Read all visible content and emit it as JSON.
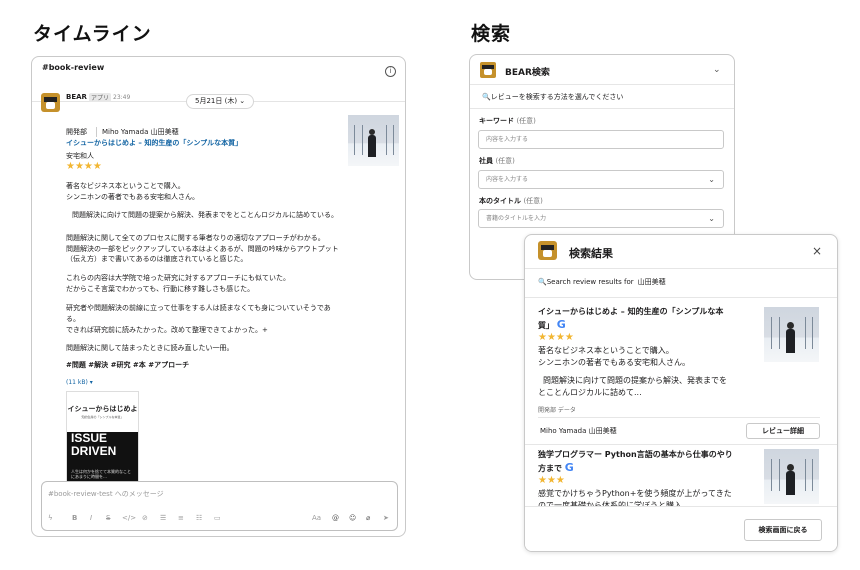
{
  "headings": {
    "timeline": "タイムライン",
    "search": "検索"
  },
  "timeline": {
    "channel": "#book-review",
    "date_pill": "5月21日 (木) ⌄",
    "bot_name": "BEAR",
    "app_badge": "アプリ",
    "time": "23:49",
    "department": "開発部",
    "person": "Miho Yamada 山田美穂",
    "book_title": "イシューからはじめよ – 知的生産の「シンプルな本質」",
    "author": "安宅和人",
    "stars": "★★★★",
    "lines": [
      "著名なビジネス本ということで購入。",
      "シンニホンの著者でもある安宅和人さん。",
      "問題解決に向けて問題の提案から解決、発表までをとことんロジカルに詰めている。",
      "問題解決に関して全てのプロセスに関する筆者なりの適切なアプローチがわかる。",
      "問題解決の一部をピックアップしている本はよくあるが、問題の吟味からアウトプット",
      "（伝え方）まで書いてあるのは徹底されていると感じた。",
      "これらの内容は大学院で培った研究に対するアプローチにも似ていた。",
      "だからこそ言葉でわかっても、行動に移す難しさも感じた。",
      "研究者や問題解決の前線に立って仕事をする人は読まなくても身についていそうであ",
      "る。",
      "できれば研究前に読みたかった。改めて整理できてよかった。+",
      "問題解決に関して詰まったときに読み直したい一冊。"
    ],
    "hashtags": "#問題 #解決 #研究 #本 #アプローチ",
    "file_size": "(11 kB) ▾",
    "book_cover": {
      "title": "イシューからはじめよ",
      "subtitle": "知的生産の「シンプルな本質」",
      "big_text": "ISSUE DRIVEN",
      "small_text": "人生は何かを捨てて本質的なことにあまりに時間を…"
    },
    "message_placeholder": "#book-review-test へのメッセージ",
    "toolbar_left": [
      "ϟ",
      "B",
      "I",
      "S",
      "</>",
      "⊘",
      "☰",
      "≡",
      "☷",
      "▭"
    ],
    "toolbar_right": [
      "Aa",
      "@",
      "☺",
      "⌀",
      "➤"
    ]
  },
  "search": {
    "title": "BEAR検索",
    "chevron": "⌄",
    "instruction": "レビューを検索する方法を選んでください",
    "fields": [
      {
        "label": "キーワード",
        "optional": "(任意)",
        "placeholder": "内容を入力する",
        "chevron": ""
      },
      {
        "label": "社員",
        "optional": "(任意)",
        "placeholder": "内容を入力する",
        "chevron": "⌄"
      },
      {
        "label": "本のタイトル",
        "optional": "(任意)",
        "placeholder": "書籍のタイトルを入力",
        "chevron": "⌄"
      }
    ]
  },
  "results": {
    "title": "検索結果",
    "close": "×",
    "query_label": "Search review results for",
    "query_value": "山田美穂",
    "items": [
      {
        "title_line1": "イシューからはじめよ – 知的生産の「シンプルな本",
        "title_line2": "質」",
        "google": "G",
        "stars": "★★★★",
        "text_lines": [
          "著名なビジネス本ということで購入。",
          "シンニホンの著者でもある安宅和人さん。",
          "問題解決に向けて問題の提案から解決、発表までを",
          "とことんロジカルに詰めて..."
        ],
        "meta": "開発部 データ",
        "reviewer": "Miho Yamada 山田美穂",
        "button": "レビュー詳細"
      },
      {
        "title_line1": "独学プログラマー Python言語の基本から仕事のやり",
        "title_line2": "方まで",
        "google": "G",
        "stars": "★★★",
        "text_lines": [
          "感覚でかけちゃうPython+を使う頻度が上がってきた",
          "ので一度基礎から体系的に学ぼうと購入"
        ]
      }
    ],
    "back_button": "検索画面に戻る"
  },
  "colors": {
    "link": "#1264a3",
    "star": "#f2b632",
    "bear_brand": "#c5912b",
    "google_blue": "#4285f4"
  }
}
